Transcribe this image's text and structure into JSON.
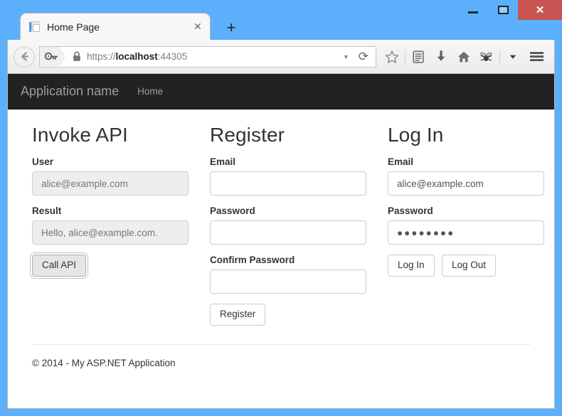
{
  "window": {
    "minimize_label": "Minimize",
    "maximize_label": "Restore",
    "close_label": "✕"
  },
  "browser": {
    "tab": {
      "title": "Home Page",
      "close_label": "✕",
      "favicon": "page-icon"
    },
    "new_tab_label": "+",
    "back_label": "←",
    "url": {
      "scheme": "https://",
      "host": "localhost",
      "port": ":44305",
      "full": "https://localhost:44305"
    },
    "url_dropdown_label": "▼",
    "reload_label": "⟳",
    "toolbar_icons": [
      "key-icon",
      "lock-icon",
      "bookmark-star-icon",
      "reader-view-icon",
      "downloads-icon",
      "home-icon",
      "bug-icon",
      "overflow-chevron-down-icon",
      "hamburger-menu-icon"
    ]
  },
  "site": {
    "brand": "Application name",
    "nav": [
      {
        "label": "Home"
      }
    ],
    "columns": [
      {
        "id": "invoke-api",
        "title": "Invoke API",
        "fields": [
          {
            "id": "user",
            "label": "User",
            "value": "alice@example.com",
            "placeholder": "",
            "disabled": true,
            "type": "text"
          },
          {
            "id": "result",
            "label": "Result",
            "value": "Hello, alice@example.com.",
            "placeholder": "",
            "disabled": true,
            "type": "text"
          }
        ],
        "buttons": [
          {
            "id": "call-api",
            "label": "Call API",
            "focused": true
          }
        ]
      },
      {
        "id": "register",
        "title": "Register",
        "fields": [
          {
            "id": "register-email",
            "label": "Email",
            "value": "",
            "placeholder": "",
            "disabled": false,
            "type": "text"
          },
          {
            "id": "register-password",
            "label": "Password",
            "value": "",
            "placeholder": "",
            "disabled": false,
            "type": "password"
          },
          {
            "id": "register-confirm-password",
            "label": "Confirm Password",
            "value": "",
            "placeholder": "",
            "disabled": false,
            "type": "password"
          }
        ],
        "buttons": [
          {
            "id": "register",
            "label": "Register",
            "focused": false
          }
        ]
      },
      {
        "id": "log-in",
        "title": "Log In",
        "fields": [
          {
            "id": "login-email",
            "label": "Email",
            "value": "alice@example.com",
            "placeholder": "",
            "disabled": false,
            "type": "text"
          },
          {
            "id": "login-password",
            "label": "Password",
            "value": "●●●●●●●●",
            "placeholder": "",
            "disabled": false,
            "type": "password"
          }
        ],
        "buttons": [
          {
            "id": "log-in",
            "label": "Log In",
            "focused": false
          },
          {
            "id": "log-out",
            "label": "Log Out",
            "focused": false
          }
        ]
      }
    ],
    "footer": "© 2014 - My ASP.NET Application"
  },
  "colors": {
    "window_frame": "#5cb0fb",
    "close_button": "#c75450",
    "navbar": "#222222",
    "disabled_input": "#eeeeee",
    "border": "#cccccc"
  }
}
